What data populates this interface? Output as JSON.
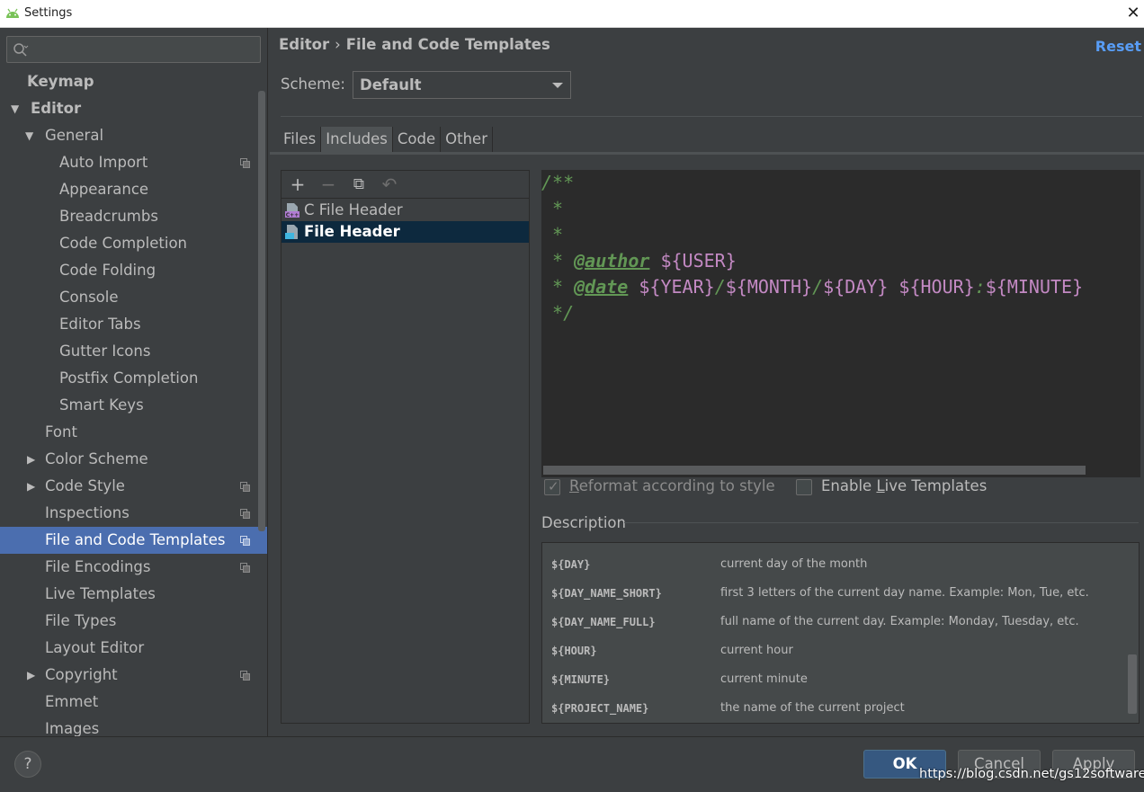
{
  "window": {
    "title": "Settings",
    "close_glyph": "✕"
  },
  "search": {
    "placeholder": ""
  },
  "sidebar": {
    "items": [
      {
        "label": "Keymap"
      },
      {
        "label": "Editor"
      },
      {
        "label": "General"
      },
      {
        "label": "Auto Import"
      },
      {
        "label": "Appearance"
      },
      {
        "label": "Breadcrumbs"
      },
      {
        "label": "Code Completion"
      },
      {
        "label": "Code Folding"
      },
      {
        "label": "Console"
      },
      {
        "label": "Editor Tabs"
      },
      {
        "label": "Gutter Icons"
      },
      {
        "label": "Postfix Completion"
      },
      {
        "label": "Smart Keys"
      },
      {
        "label": "Font"
      },
      {
        "label": "Color Scheme"
      },
      {
        "label": "Code Style"
      },
      {
        "label": "Inspections"
      },
      {
        "label": "File and Code Templates"
      },
      {
        "label": "File Encodings"
      },
      {
        "label": "Live Templates"
      },
      {
        "label": "File Types"
      },
      {
        "label": "Layout Editor"
      },
      {
        "label": "Copyright"
      },
      {
        "label": "Emmet"
      },
      {
        "label": "Images"
      }
    ],
    "selected": "File and Code Templates"
  },
  "header": {
    "breadcrumb_root": "Editor",
    "breadcrumb_sep": "›",
    "breadcrumb_page": "File and Code Templates",
    "reset": "Reset"
  },
  "scheme": {
    "label": "Scheme:",
    "value": "Default"
  },
  "tabs": [
    {
      "label": "Files"
    },
    {
      "label": "Includes"
    },
    {
      "label": "Code"
    },
    {
      "label": "Other"
    }
  ],
  "active_tab": "Includes",
  "toolbar": {
    "add": "+",
    "remove": "−",
    "copy": "⧉",
    "revert": "↶"
  },
  "templates": [
    {
      "label": "C File Header"
    },
    {
      "label": "File Header"
    }
  ],
  "selected_template": "File Header",
  "editor": {
    "line1": "/**",
    "line2": " *",
    "line3": " *",
    "author_prefix": " * ",
    "author_tag": "@author",
    "author_var": "${USER}",
    "date_prefix": " * ",
    "date_tag": "@date",
    "date_year": "${YEAR}",
    "date_slash1": "/",
    "date_month": "${MONTH}",
    "date_slash2": "/",
    "date_day": "${DAY}",
    "date_hour": "${HOUR}",
    "date_colon": ":",
    "date_minute": "${MINUTE}",
    "line_end": " */"
  },
  "options": {
    "reformat_pre": "R",
    "reformat_rest": "eformat according to style",
    "reformat_checked": true,
    "live_pre": "Enable ",
    "live_ul": "L",
    "live_rest": "ive Templates",
    "live_checked": false
  },
  "description": {
    "title": "Description",
    "rows": [
      {
        "key": "${DAY}",
        "value": "current day of the month"
      },
      {
        "key": "${DAY_NAME_SHORT}",
        "value": "first 3 letters of the current day name. Example: Mon, Tue, etc."
      },
      {
        "key": "${DAY_NAME_FULL}",
        "value": "full name of the current day. Example: Monday, Tuesday, etc."
      },
      {
        "key": "${HOUR}",
        "value": "current hour"
      },
      {
        "key": "${MINUTE}",
        "value": "current minute"
      },
      {
        "key": "${PROJECT_NAME}",
        "value": "the name of the current project"
      }
    ]
  },
  "buttons": {
    "help": "?",
    "ok": "OK",
    "cancel": "Cancel",
    "apply": "Apply"
  },
  "watermark": "https://blog.csdn.net/gs12software",
  "colors": {
    "selection": "#4b6eaf",
    "link": "#589df6",
    "comment": "#629755",
    "template_var": "#c389c3",
    "ok_button": "#365880"
  }
}
